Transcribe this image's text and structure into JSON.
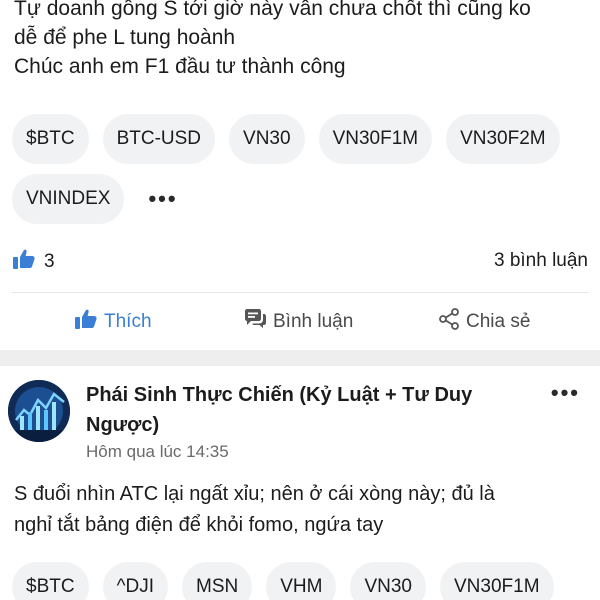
{
  "post1": {
    "text_lines": [
      "Tự doanh gồng S tới giờ này vẫn chưa chốt thì cũng ko",
      "dễ để phe L tung hoành",
      "Chúc anh em F1 đầu tư thành công"
    ],
    "tags": [
      "$BTC",
      "BTC-USD",
      "VN30",
      "VN30F1M",
      "VN30F2M",
      "VNINDEX"
    ],
    "more_tags": "•••",
    "like_count": "3",
    "comment_count": "3 bình luận",
    "actions": {
      "like": "Thích",
      "comment": "Bình luận",
      "share": "Chia sẻ"
    }
  },
  "post2": {
    "author": "Phái Sinh Thực Chiến (Kỷ Luật + Tư Duy Ngược)",
    "time": "Hôm qua lúc 14:35",
    "more": "•••",
    "text_lines": [
      "S đuổi nhìn ATC lại ngất xỉu; nên ở cái xòng này; đủ là",
      "nghỉ tắt bảng điện để khỏi fomo, ngứa tay"
    ],
    "tags": [
      "$BTC",
      "^DJI",
      "MSN",
      "VHM",
      "VN30",
      "VN30F1M"
    ]
  },
  "colors": {
    "accent": "#3a7fd5",
    "tag_bg": "#f1f2f4",
    "separator": "#eeeeee"
  }
}
